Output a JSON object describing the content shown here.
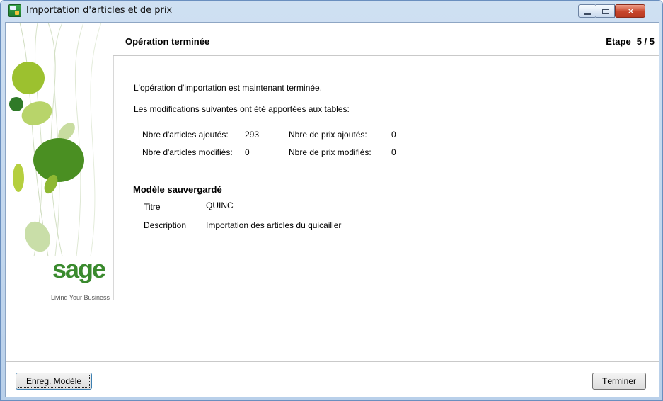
{
  "window": {
    "title": "Importation d'articles et de prix",
    "controls": [
      "minimize-icon",
      "maximize-icon",
      "close-icon"
    ]
  },
  "header": {
    "step_title": "Opération terminée",
    "step_label": "Etape",
    "step_value": "5 / 5"
  },
  "sidebar": {
    "logo_text": "sage",
    "tagline": "Living Your Business",
    "accent_color": "#3a8a2e"
  },
  "main": {
    "intro": "L'opération d'importation est maintenant terminée.",
    "changes_intro": "Les modifications suivantes ont été apportées aux tables:",
    "stats": {
      "articles_added_label": "Nbre d'articles ajoutés:",
      "articles_added_value": "293",
      "articles_modified_label": "Nbre d'articles modifiés:",
      "articles_modified_value": "0",
      "prices_added_label": "Nbre de prix ajoutés:",
      "prices_added_value": "0",
      "prices_modified_label": "Nbre de prix modifiés:",
      "prices_modified_value": "0"
    },
    "model": {
      "heading": "Modèle sauvergardé",
      "title_label": "Titre",
      "title_value": "QUINC",
      "description_label": "Description",
      "description_value": "Importation des articles du quicailler"
    }
  },
  "footer": {
    "save_model": {
      "accel": "E",
      "rest": "nreg. Modèle"
    },
    "finish": {
      "accel": "T",
      "rest": "erminer"
    }
  }
}
